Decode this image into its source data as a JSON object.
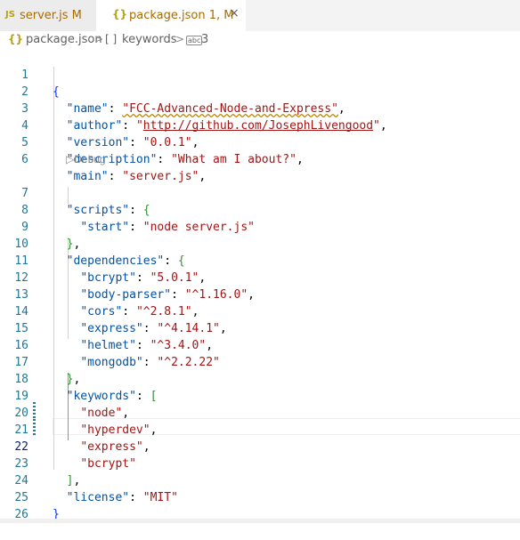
{
  "tabs": [
    {
      "icon": "JS",
      "title": "server.js M"
    },
    {
      "icon": "{}",
      "title": "package.json 1, M",
      "close": "×"
    }
  ],
  "breadcrumb": {
    "file_icon": "{}",
    "file": "package.json",
    "sep": ">",
    "symbol_icon": "[ ]",
    "symbol": "keywords",
    "string_icon": "abc",
    "string": "3"
  },
  "codelens": "Debug",
  "code": {
    "open_brace": "{",
    "name_key": "\"name\"",
    "name_value": "\"FCC-Advanced-Node-and-Express\"",
    "author_key": "\"author\"",
    "author_value_q1": "\"",
    "author_value": "http://github.com/JosephLivengood",
    "author_value_q2": "\"",
    "version_key": "\"version\"",
    "version_value": "\"0.0.1\"",
    "description_key": "\"description\"",
    "description_value": "\"What am I about?\"",
    "main_key": "\"main\"",
    "main_value": "\"server.js\"",
    "scripts_key": "\"scripts\"",
    "scripts_open": "{",
    "start_key": "\"start\"",
    "start_value": "\"node server.js\"",
    "scripts_close": "}",
    "dependencies_key": "\"dependencies\"",
    "dependencies_open": "{",
    "deps": [
      {
        "key": "\"bcrypt\"",
        "value": "\"5.0.1\""
      },
      {
        "key": "\"body-parser\"",
        "value": "\"^1.16.0\""
      },
      {
        "key": "\"cors\"",
        "value": "\"^2.8.1\""
      },
      {
        "key": "\"express\"",
        "value": "\"^4.14.1\""
      },
      {
        "key": "\"helmet\"",
        "value": "\"^3.4.0\""
      },
      {
        "key": "\"mongodb\"",
        "value": "\"^2.2.22\""
      }
    ],
    "dependencies_close": "}",
    "keywords_key": "\"keywords\"",
    "keywords_open": "[",
    "keywords": [
      "\"node\"",
      "\"hyperdev\"",
      "\"express\"",
      "\"bcrypt\""
    ],
    "keywords_close": "]",
    "license_key": "\"license\"",
    "license_value": "\"MIT\"",
    "close_brace": "}"
  },
  "line_numbers": [
    "1",
    "2",
    "3",
    "4",
    "5",
    "6",
    "7",
    "8",
    "9",
    "10",
    "11",
    "12",
    "13",
    "14",
    "15",
    "16",
    "17",
    "18",
    "19",
    "20",
    "21",
    "22",
    "23",
    "24",
    "25",
    "26"
  ],
  "active_line": "22",
  "colors": {
    "key": "#0451a5",
    "string": "#a31515",
    "bracket_level1": "#0431fa",
    "bracket_level2": "#319331",
    "bracket_level3": "#7b3814",
    "line_number": "#237893",
    "modified_tab": "#a86b00",
    "gutter_dirty": "#1b81a8"
  }
}
